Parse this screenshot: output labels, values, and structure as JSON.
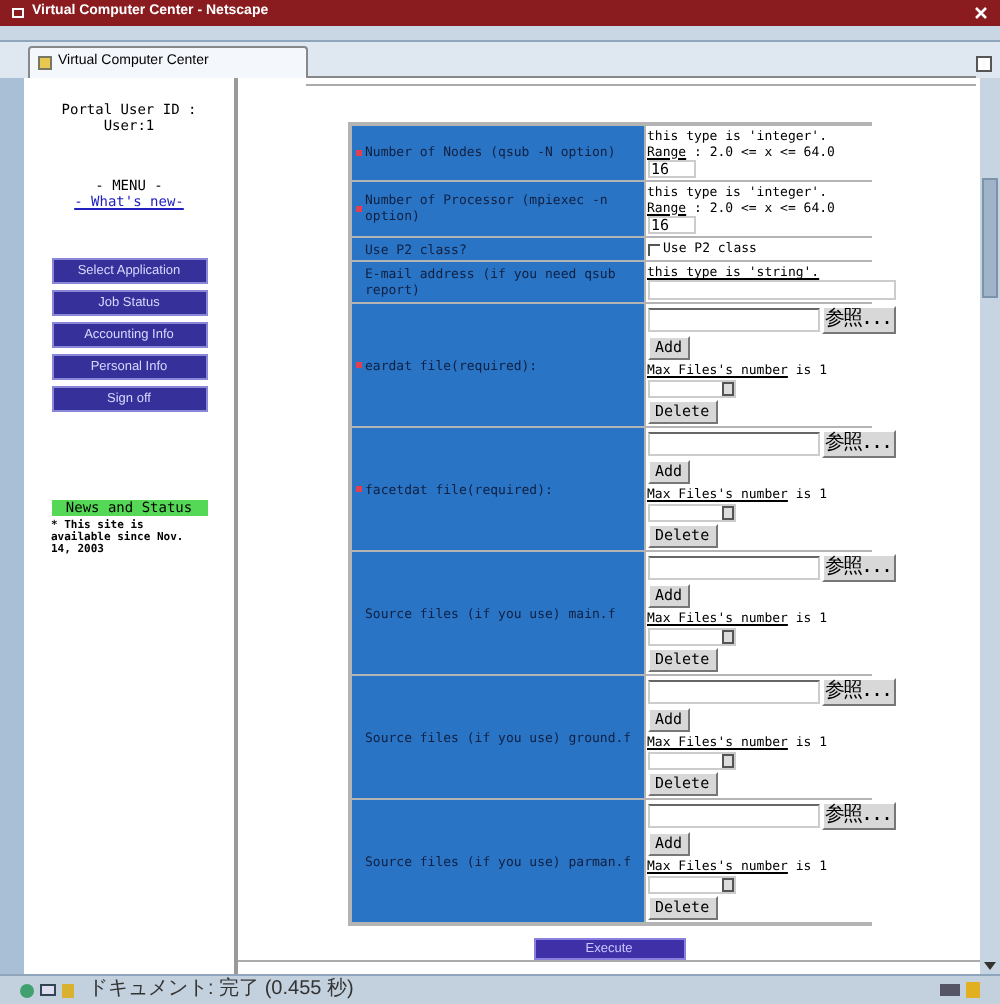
{
  "window": {
    "title": "Virtual Computer Center - Netscape"
  },
  "tabs": [
    {
      "label": "Virtual Computer Center",
      "selected": true
    }
  ],
  "sidebar": {
    "user_label": "Portal User ID :",
    "user_value": "User:1",
    "menu_title": "- MENU -",
    "whats_new": "- What's new-",
    "buttons": [
      "Select Application",
      "Job Status",
      "Accounting Info",
      "Personal Info",
      "Sign off"
    ],
    "news_title": "News and Status",
    "news_text": "* This site is available since Nov. 14, 2003"
  },
  "form": {
    "rows": [
      {
        "kind": "integer",
        "label": "Number of Nodes (qsub -N option)",
        "required": true,
        "hint": "this type is 'integer'.",
        "range_label": "Range",
        "range_text": " : 2.0 <= x <= 64.0",
        "value": "16"
      },
      {
        "kind": "integer",
        "label": "Number of Processor (mpiexec -n option)",
        "required": true,
        "hint": "this type is 'integer'.",
        "range_label": "Range",
        "range_text": " : 2.0 <= x <= 64.0",
        "value": "16"
      },
      {
        "kind": "checkbox",
        "label": "Use P2 class?",
        "required": false,
        "option": "Use P2 class",
        "checked": false
      },
      {
        "kind": "string",
        "label": "E-mail address (if you need qsub report)",
        "required": false,
        "hint": "this type is 'string'."
      },
      {
        "kind": "file",
        "label": "eardat file(required):",
        "required": true,
        "browse": "参照...",
        "add": "Add",
        "max_label": "Max Files's number",
        "max_text": " is 1",
        "delete": "Delete"
      },
      {
        "kind": "file",
        "label": "facetdat file(required):",
        "required": true,
        "browse": "参照...",
        "add": "Add",
        "max_label": "Max Files's number",
        "max_text": " is 1",
        "delete": "Delete"
      },
      {
        "kind": "file",
        "label": "Source files (if you use) main.f",
        "required": false,
        "browse": "参照...",
        "add": "Add",
        "max_label": "Max Files's number",
        "max_text": " is 1",
        "delete": "Delete"
      },
      {
        "kind": "file",
        "label": "Source files (if you use) ground.f",
        "required": false,
        "browse": "参照...",
        "add": "Add",
        "max_label": "Max Files's number",
        "max_text": " is 1",
        "delete": "Delete"
      },
      {
        "kind": "file",
        "label": "Source files (if you use) parman.f",
        "required": false,
        "browse": "参照...",
        "add": "Add",
        "max_label": "Max Files's number",
        "max_text": " is 1",
        "delete": "Delete"
      }
    ],
    "execute": "Execute"
  },
  "status_bar": {
    "text": "ドキュメント: 完了 (0.455 秒)"
  }
}
